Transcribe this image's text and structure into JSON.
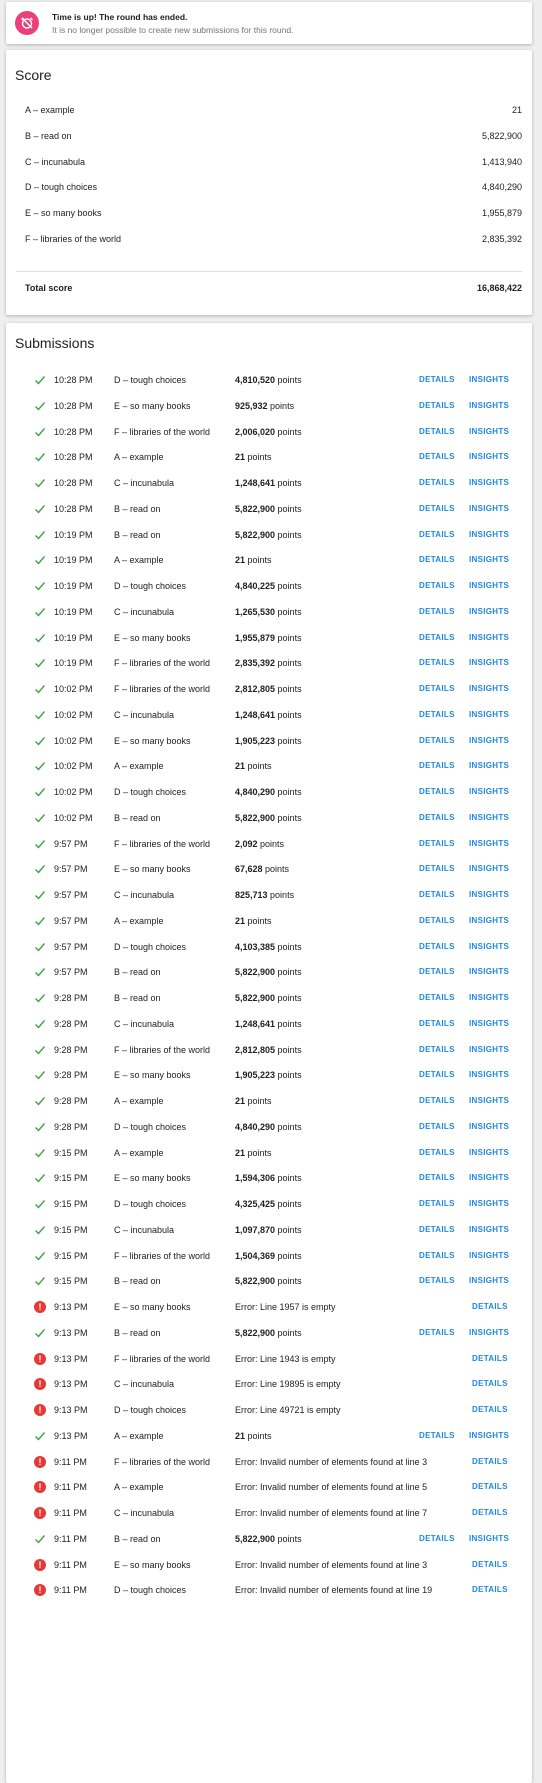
{
  "banner": {
    "title": "Time is up! The round has ended.",
    "subtitle": "It is no longer possible to create new submissions for this round."
  },
  "score": {
    "title": "Score",
    "rows": [
      {
        "name": "A – example",
        "value": "21"
      },
      {
        "name": "B – read on",
        "value": "5,822,900"
      },
      {
        "name": "C – incunabula",
        "value": "1,413,940"
      },
      {
        "name": "D – tough choices",
        "value": "4,840,290"
      },
      {
        "name": "E – so many books",
        "value": "1,955,879"
      },
      {
        "name": "F – libraries of the world",
        "value": "2,835,392"
      }
    ],
    "total_label": "Total score",
    "total_value": "16,868,422"
  },
  "submissions": {
    "title": "Submissions",
    "details_label": "DETAILS",
    "insights_label": "INSIGHTS",
    "points_suffix": " points",
    "rows": [
      {
        "status": "ok",
        "time": "10:28 PM",
        "problem": "D – tough choices",
        "points": "4,810,520"
      },
      {
        "status": "ok",
        "time": "10:28 PM",
        "problem": "E – so many books",
        "points": "925,932"
      },
      {
        "status": "ok",
        "time": "10:28 PM",
        "problem": "F – libraries of the world",
        "points": "2,006,020"
      },
      {
        "status": "ok",
        "time": "10:28 PM",
        "problem": "A – example",
        "points": "21"
      },
      {
        "status": "ok",
        "time": "10:28 PM",
        "problem": "C – incunabula",
        "points": "1,248,641"
      },
      {
        "status": "ok",
        "time": "10:28 PM",
        "problem": "B – read on",
        "points": "5,822,900"
      },
      {
        "status": "ok",
        "time": "10:19 PM",
        "problem": "B – read on",
        "points": "5,822,900"
      },
      {
        "status": "ok",
        "time": "10:19 PM",
        "problem": "A – example",
        "points": "21"
      },
      {
        "status": "ok",
        "time": "10:19 PM",
        "problem": "D – tough choices",
        "points": "4,840,225"
      },
      {
        "status": "ok",
        "time": "10:19 PM",
        "problem": "C – incunabula",
        "points": "1,265,530"
      },
      {
        "status": "ok",
        "time": "10:19 PM",
        "problem": "E – so many books",
        "points": "1,955,879"
      },
      {
        "status": "ok",
        "time": "10:19 PM",
        "problem": "F – libraries of the world",
        "points": "2,835,392"
      },
      {
        "status": "ok",
        "time": "10:02 PM",
        "problem": "F – libraries of the world",
        "points": "2,812,805"
      },
      {
        "status": "ok",
        "time": "10:02 PM",
        "problem": "C – incunabula",
        "points": "1,248,641"
      },
      {
        "status": "ok",
        "time": "10:02 PM",
        "problem": "E – so many books",
        "points": "1,905,223"
      },
      {
        "status": "ok",
        "time": "10:02 PM",
        "problem": "A – example",
        "points": "21"
      },
      {
        "status": "ok",
        "time": "10:02 PM",
        "problem": "D – tough choices",
        "points": "4,840,290"
      },
      {
        "status": "ok",
        "time": "10:02 PM",
        "problem": "B – read on",
        "points": "5,822,900"
      },
      {
        "status": "ok",
        "time": "9:57 PM",
        "problem": "F – libraries of the world",
        "points": "2,092"
      },
      {
        "status": "ok",
        "time": "9:57 PM",
        "problem": "E – so many books",
        "points": "67,628"
      },
      {
        "status": "ok",
        "time": "9:57 PM",
        "problem": "C – incunabula",
        "points": "825,713"
      },
      {
        "status": "ok",
        "time": "9:57 PM",
        "problem": "A – example",
        "points": "21"
      },
      {
        "status": "ok",
        "time": "9:57 PM",
        "problem": "D – tough choices",
        "points": "4,103,385"
      },
      {
        "status": "ok",
        "time": "9:57 PM",
        "problem": "B – read on",
        "points": "5,822,900"
      },
      {
        "status": "ok",
        "time": "9:28 PM",
        "problem": "B – read on",
        "points": "5,822,900"
      },
      {
        "status": "ok",
        "time": "9:28 PM",
        "problem": "C – incunabula",
        "points": "1,248,641"
      },
      {
        "status": "ok",
        "time": "9:28 PM",
        "problem": "F – libraries of the world",
        "points": "2,812,805"
      },
      {
        "status": "ok",
        "time": "9:28 PM",
        "problem": "E – so many books",
        "points": "1,905,223"
      },
      {
        "status": "ok",
        "time": "9:28 PM",
        "problem": "A – example",
        "points": "21"
      },
      {
        "status": "ok",
        "time": "9:28 PM",
        "problem": "D – tough choices",
        "points": "4,840,290"
      },
      {
        "status": "ok",
        "time": "9:15 PM",
        "problem": "A – example",
        "points": "21"
      },
      {
        "status": "ok",
        "time": "9:15 PM",
        "problem": "E – so many books",
        "points": "1,594,306"
      },
      {
        "status": "ok",
        "time": "9:15 PM",
        "problem": "D – tough choices",
        "points": "4,325,425"
      },
      {
        "status": "ok",
        "time": "9:15 PM",
        "problem": "C – incunabula",
        "points": "1,097,870"
      },
      {
        "status": "ok",
        "time": "9:15 PM",
        "problem": "F – libraries of the world",
        "points": "1,504,369"
      },
      {
        "status": "ok",
        "time": "9:15 PM",
        "problem": "B – read on",
        "points": "5,822,900"
      },
      {
        "status": "error",
        "time": "9:13 PM",
        "problem": "E – so many books",
        "error": "Error: Line 1957 is empty"
      },
      {
        "status": "ok",
        "time": "9:13 PM",
        "problem": "B – read on",
        "points": "5,822,900"
      },
      {
        "status": "error",
        "time": "9:13 PM",
        "problem": "F – libraries of the world",
        "error": "Error: Line 1943 is empty"
      },
      {
        "status": "error",
        "time": "9:13 PM",
        "problem": "C – incunabula",
        "error": "Error: Line 19895 is empty"
      },
      {
        "status": "error",
        "time": "9:13 PM",
        "problem": "D – tough choices",
        "error": "Error: Line 49721 is empty"
      },
      {
        "status": "ok",
        "time": "9:13 PM",
        "problem": "A – example",
        "points": "21"
      },
      {
        "status": "error",
        "time": "9:11 PM",
        "problem": "F – libraries of the world",
        "error": "Error: Invalid number of elements found at line 3"
      },
      {
        "status": "error",
        "time": "9:11 PM",
        "problem": "A – example",
        "error": "Error: Invalid number of elements found at line 5"
      },
      {
        "status": "error",
        "time": "9:11 PM",
        "problem": "C – incunabula",
        "error": "Error: Invalid number of elements found at line 7"
      },
      {
        "status": "ok",
        "time": "9:11 PM",
        "problem": "B – read on",
        "points": "5,822,900"
      },
      {
        "status": "error",
        "time": "9:11 PM",
        "problem": "E – so many books",
        "error": "Error: Invalid number of elements found at line 3"
      },
      {
        "status": "error",
        "time": "9:11 PM",
        "problem": "D – tough choices",
        "error": "Error: Invalid number of elements found at line 19"
      }
    ]
  },
  "colors": {
    "accent": "#1e88e5",
    "ok": "#43a047",
    "error": "#e53935",
    "alarm": "#ec407a"
  }
}
